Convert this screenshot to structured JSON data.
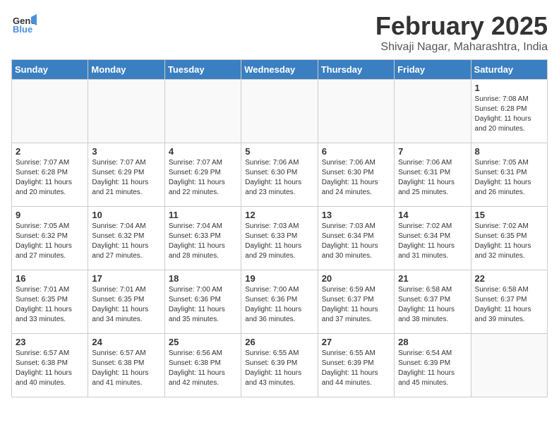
{
  "header": {
    "logo_line1": "General",
    "logo_line2": "Blue",
    "month": "February 2025",
    "location": "Shivaji Nagar, Maharashtra, India"
  },
  "weekdays": [
    "Sunday",
    "Monday",
    "Tuesday",
    "Wednesday",
    "Thursday",
    "Friday",
    "Saturday"
  ],
  "weeks": [
    [
      {
        "day": "",
        "info": ""
      },
      {
        "day": "",
        "info": ""
      },
      {
        "day": "",
        "info": ""
      },
      {
        "day": "",
        "info": ""
      },
      {
        "day": "",
        "info": ""
      },
      {
        "day": "",
        "info": ""
      },
      {
        "day": "1",
        "info": "Sunrise: 7:08 AM\nSunset: 6:28 PM\nDaylight: 11 hours\nand 20 minutes."
      }
    ],
    [
      {
        "day": "2",
        "info": "Sunrise: 7:07 AM\nSunset: 6:28 PM\nDaylight: 11 hours\nand 20 minutes."
      },
      {
        "day": "3",
        "info": "Sunrise: 7:07 AM\nSunset: 6:29 PM\nDaylight: 11 hours\nand 21 minutes."
      },
      {
        "day": "4",
        "info": "Sunrise: 7:07 AM\nSunset: 6:29 PM\nDaylight: 11 hours\nand 22 minutes."
      },
      {
        "day": "5",
        "info": "Sunrise: 7:06 AM\nSunset: 6:30 PM\nDaylight: 11 hours\nand 23 minutes."
      },
      {
        "day": "6",
        "info": "Sunrise: 7:06 AM\nSunset: 6:30 PM\nDaylight: 11 hours\nand 24 minutes."
      },
      {
        "day": "7",
        "info": "Sunrise: 7:06 AM\nSunset: 6:31 PM\nDaylight: 11 hours\nand 25 minutes."
      },
      {
        "day": "8",
        "info": "Sunrise: 7:05 AM\nSunset: 6:31 PM\nDaylight: 11 hours\nand 26 minutes."
      }
    ],
    [
      {
        "day": "9",
        "info": "Sunrise: 7:05 AM\nSunset: 6:32 PM\nDaylight: 11 hours\nand 27 minutes."
      },
      {
        "day": "10",
        "info": "Sunrise: 7:04 AM\nSunset: 6:32 PM\nDaylight: 11 hours\nand 27 minutes."
      },
      {
        "day": "11",
        "info": "Sunrise: 7:04 AM\nSunset: 6:33 PM\nDaylight: 11 hours\nand 28 minutes."
      },
      {
        "day": "12",
        "info": "Sunrise: 7:03 AM\nSunset: 6:33 PM\nDaylight: 11 hours\nand 29 minutes."
      },
      {
        "day": "13",
        "info": "Sunrise: 7:03 AM\nSunset: 6:34 PM\nDaylight: 11 hours\nand 30 minutes."
      },
      {
        "day": "14",
        "info": "Sunrise: 7:02 AM\nSunset: 6:34 PM\nDaylight: 11 hours\nand 31 minutes."
      },
      {
        "day": "15",
        "info": "Sunrise: 7:02 AM\nSunset: 6:35 PM\nDaylight: 11 hours\nand 32 minutes."
      }
    ],
    [
      {
        "day": "16",
        "info": "Sunrise: 7:01 AM\nSunset: 6:35 PM\nDaylight: 11 hours\nand 33 minutes."
      },
      {
        "day": "17",
        "info": "Sunrise: 7:01 AM\nSunset: 6:35 PM\nDaylight: 11 hours\nand 34 minutes."
      },
      {
        "day": "18",
        "info": "Sunrise: 7:00 AM\nSunset: 6:36 PM\nDaylight: 11 hours\nand 35 minutes."
      },
      {
        "day": "19",
        "info": "Sunrise: 7:00 AM\nSunset: 6:36 PM\nDaylight: 11 hours\nand 36 minutes."
      },
      {
        "day": "20",
        "info": "Sunrise: 6:59 AM\nSunset: 6:37 PM\nDaylight: 11 hours\nand 37 minutes."
      },
      {
        "day": "21",
        "info": "Sunrise: 6:58 AM\nSunset: 6:37 PM\nDaylight: 11 hours\nand 38 minutes."
      },
      {
        "day": "22",
        "info": "Sunrise: 6:58 AM\nSunset: 6:37 PM\nDaylight: 11 hours\nand 39 minutes."
      }
    ],
    [
      {
        "day": "23",
        "info": "Sunrise: 6:57 AM\nSunset: 6:38 PM\nDaylight: 11 hours\nand 40 minutes."
      },
      {
        "day": "24",
        "info": "Sunrise: 6:57 AM\nSunset: 6:38 PM\nDaylight: 11 hours\nand 41 minutes."
      },
      {
        "day": "25",
        "info": "Sunrise: 6:56 AM\nSunset: 6:38 PM\nDaylight: 11 hours\nand 42 minutes."
      },
      {
        "day": "26",
        "info": "Sunrise: 6:55 AM\nSunset: 6:39 PM\nDaylight: 11 hours\nand 43 minutes."
      },
      {
        "day": "27",
        "info": "Sunrise: 6:55 AM\nSunset: 6:39 PM\nDaylight: 11 hours\nand 44 minutes."
      },
      {
        "day": "28",
        "info": "Sunrise: 6:54 AM\nSunset: 6:39 PM\nDaylight: 11 hours\nand 45 minutes."
      },
      {
        "day": "",
        "info": ""
      }
    ]
  ]
}
